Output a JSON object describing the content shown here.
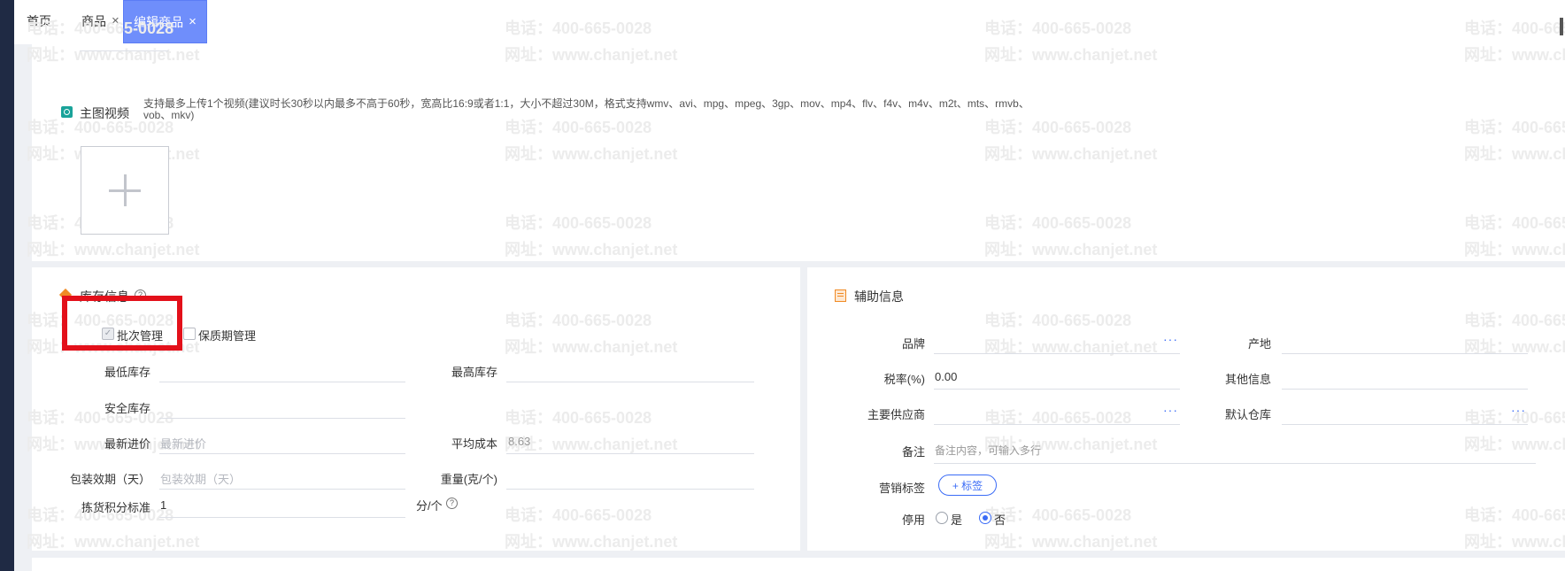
{
  "tabs": [
    {
      "label": "首页",
      "closable": false,
      "active": false
    },
    {
      "label": "商品",
      "closable": true,
      "active": false
    },
    {
      "label": "编辑商品",
      "closable": true,
      "active": true
    }
  ],
  "close_glyph": "×",
  "watermark": {
    "phone": "电话：400-665-0028",
    "site": "网址：www.chanjet.net"
  },
  "main_video": {
    "title": "主图视频",
    "hint_line1": "支持最多上传1个视频(建议时长30秒以内最多不高于60秒，宽高比16:9或者1:1，大小不超过30M，格式支持wmv、avi、mpg、mpeg、3gp、mov、mp4、flv、f4v、m4v、m2t、mts、rmvb、",
    "hint_line2": "vob、mkv)",
    "icon": "video-icon",
    "upload_icon": "plus-icon"
  },
  "inventory": {
    "title": "库存信息",
    "batch_label": "批次管理",
    "batch_checked": true,
    "shelf_label": "保质期管理",
    "shelf_checked": false,
    "min_stock_label": "最低库存",
    "max_stock_label": "最高库存",
    "safe_stock_label": "安全库存",
    "latest_price_label": "最新进价",
    "latest_price_placeholder": "最新进价",
    "avg_cost_label": "平均成本",
    "avg_cost_value": "8.63",
    "pack_label": "包装效期（天）",
    "pack_placeholder": "包装效期（天）",
    "weight_label": "重量(克/个)",
    "points_label": "拣货积分标准",
    "points_value": "1",
    "points_unit": "分/个"
  },
  "aux": {
    "title": "辅助信息",
    "brand_label": "品牌",
    "origin_label": "产地",
    "tax_label": "税率(%)",
    "tax_value": "0.00",
    "other_label": "其他信息",
    "supplier_label": "主要供应商",
    "warehouse_label": "默认仓库",
    "remark_label": "备注",
    "remark_placeholder": "备注内容，可输入多行",
    "tag_label": "营销标签",
    "tag_button": "+ 标签",
    "disable_label": "停用",
    "yes": "是",
    "no": "否",
    "disabled": false,
    "more_glyph": "···"
  },
  "colors": {
    "accent": "#3b6cf6",
    "active_tab": "#6f8efb",
    "highlight": "#e3101a",
    "section_icon": "#f08a24"
  }
}
